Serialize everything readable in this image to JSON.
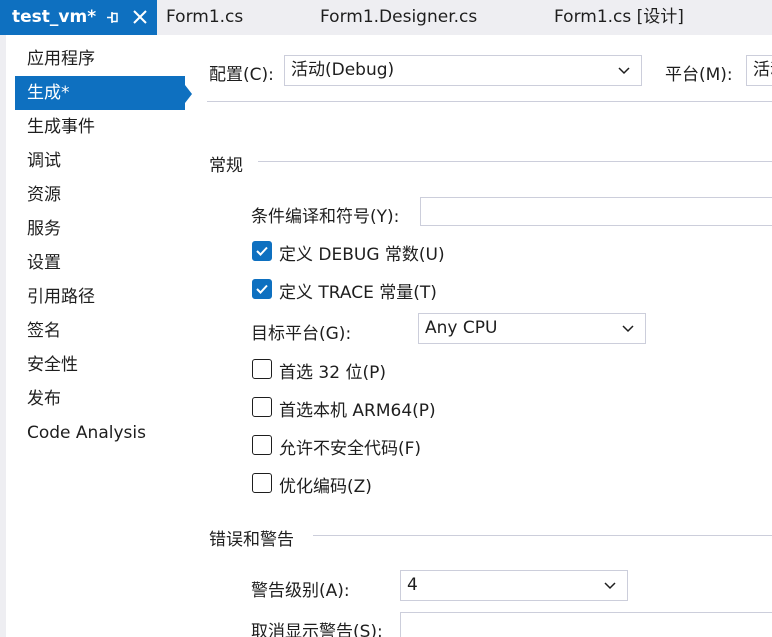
{
  "tabs": [
    {
      "label": "test_vm*",
      "active": true
    },
    {
      "label": "Form1.cs",
      "active": false
    },
    {
      "label": "Form1.Designer.cs",
      "active": false
    },
    {
      "label": "Form1.cs [设计]",
      "active": false
    }
  ],
  "sidebar": {
    "items": [
      {
        "label": "应用程序"
      },
      {
        "label": "生成*",
        "selected": true
      },
      {
        "label": "生成事件"
      },
      {
        "label": "调试"
      },
      {
        "label": "资源"
      },
      {
        "label": "服务"
      },
      {
        "label": "设置"
      },
      {
        "label": "引用路径"
      },
      {
        "label": "签名"
      },
      {
        "label": "安全性"
      },
      {
        "label": "发布"
      },
      {
        "label": "Code Analysis"
      }
    ]
  },
  "config": {
    "config_label": "配置(C):",
    "config_value": "活动(Debug)",
    "platform_label": "平台(M):",
    "platform_value": "活动"
  },
  "general": {
    "title": "常规",
    "symbols_label": "条件编译和符号(Y):",
    "symbols_value": "",
    "define_debug": {
      "label": "定义 DEBUG 常数(U)",
      "checked": true
    },
    "define_trace": {
      "label": "定义 TRACE 常量(T)",
      "checked": true
    },
    "target_label": "目标平台(G):",
    "target_value": "Any CPU",
    "prefer32": {
      "label": "首选 32 位(P)",
      "checked": false
    },
    "prefer_arm64": {
      "label": "首选本机 ARM64(P)",
      "checked": false
    },
    "allow_unsafe": {
      "label": "允许不安全代码(F)",
      "checked": false
    },
    "optimize": {
      "label": "优化编码(Z)",
      "checked": false
    }
  },
  "errors": {
    "title": "错误和警告",
    "warning_level_label": "警告级别(A):",
    "warning_level_value": "4",
    "suppress_label": "取消显示警告(S):",
    "suppress_value": ""
  },
  "colors": {
    "accent": "#0e70c0",
    "tabbar_bg": "#eeeef2",
    "border": "#cccedb"
  }
}
